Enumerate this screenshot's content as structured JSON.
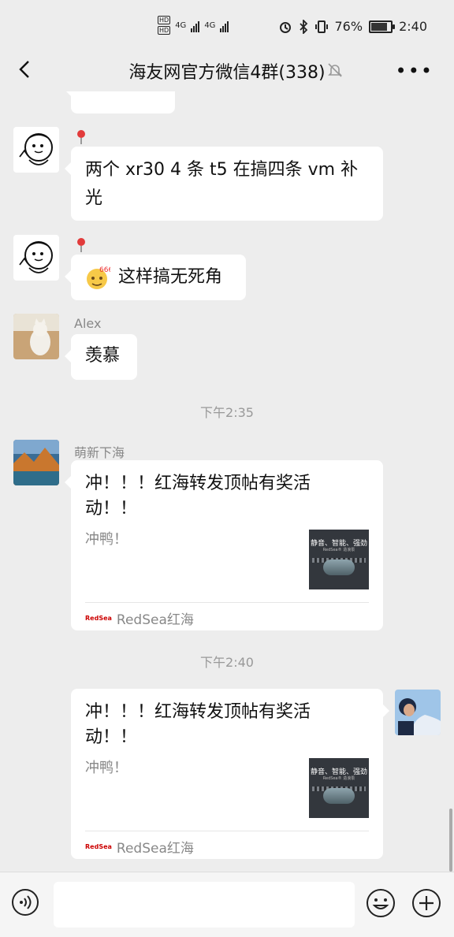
{
  "status_bar": {
    "hd_labels": [
      "HD",
      "HD"
    ],
    "net1": "4G",
    "net2": "4G",
    "battery_pct": "76%",
    "battery_level": 0.76,
    "time": "2:40"
  },
  "header": {
    "title": "海友网官方微信4群(338)"
  },
  "messages": [
    {
      "text": "两个 xr30  4 条 t5  在搞四条 vm 补光"
    },
    {
      "emoji_label": "666",
      "text": "这样搞无死角"
    },
    {
      "sender": "Alex",
      "text": "羡慕"
    }
  ],
  "timestamps": [
    "下午2:35",
    "下午2:40"
  ],
  "cards": [
    {
      "sender": "萌新下海",
      "title": "冲！！！红海转发顶帖有奖活动！！",
      "desc": "冲鸭！",
      "thumb_title": "静音、智能、强劲",
      "thumb_sub": "RedSea® 造浪泵",
      "source_logo": "RedSea",
      "source": "RedSea红海"
    },
    {
      "title": "冲！！！红海转发顶帖有奖活动！！",
      "desc": "冲鸭！",
      "thumb_title": "静音、智能、强劲",
      "thumb_sub": "RedSea® 造浪泵",
      "source_logo": "RedSea",
      "source": "RedSea红海"
    }
  ]
}
